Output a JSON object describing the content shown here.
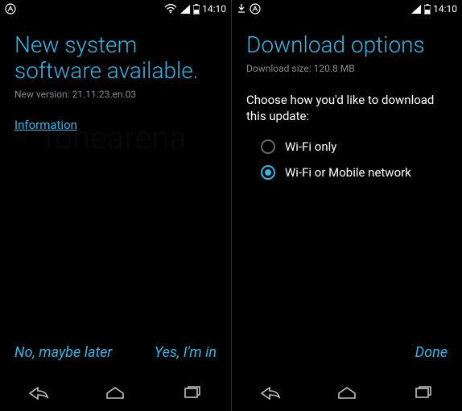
{
  "accent": "#33b5e5",
  "status": {
    "time": "14:10"
  },
  "screen1": {
    "title": "New system software available.",
    "subtitle_prefix": "New version: ",
    "version": "21.11.23.en.03",
    "info_link": "Information",
    "btn_no": "No, maybe later",
    "btn_yes": "Yes, I'm in"
  },
  "screen2": {
    "title": "Download options",
    "size_prefix": "Download size: ",
    "size": "120.8 MB",
    "prompt": "Choose how you'd like to download this update:",
    "options": [
      "Wi-Fi only",
      "Wi-Fi or Mobile network"
    ],
    "selected_index": 1,
    "btn_done": "Done"
  },
  "watermark": "fonearena"
}
